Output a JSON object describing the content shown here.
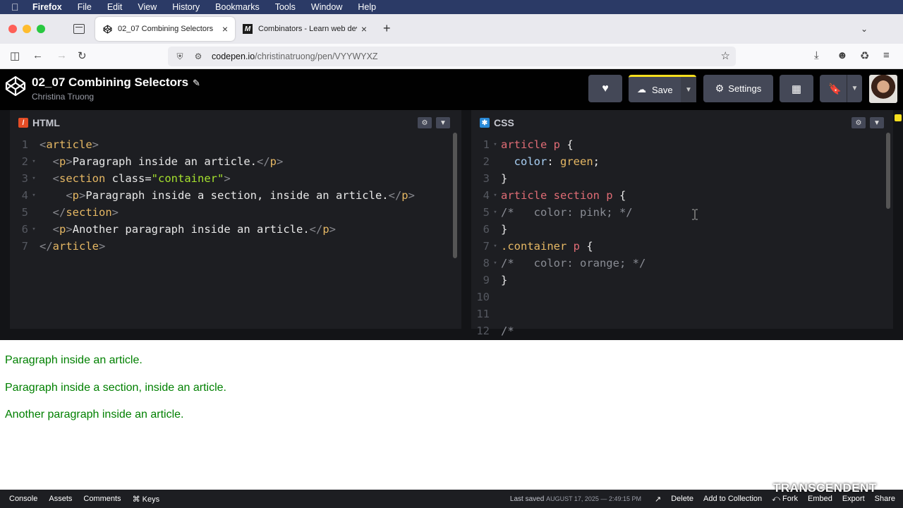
{
  "menubar": {
    "app": "Firefox",
    "items": [
      "File",
      "Edit",
      "View",
      "History",
      "Bookmarks",
      "Tools",
      "Window",
      "Help"
    ]
  },
  "browser": {
    "tabs": [
      {
        "title": "02_07 Combining Selectors",
        "active": true
      },
      {
        "title": "Combinators - Learn web develo",
        "active": false
      }
    ],
    "url_host": "codepen.io",
    "url_path": "/christinatruong/pen/VYYWYXZ"
  },
  "codepen": {
    "pen_title": "02_07 Combining Selectors",
    "author": "Christina Truong",
    "buttons": {
      "save": "Save",
      "settings": "Settings"
    }
  },
  "editors": {
    "html": {
      "label": "HTML",
      "lines": [
        [
          [
            "t-punct",
            "<"
          ],
          [
            "t-name",
            "article"
          ],
          [
            "t-punct",
            ">"
          ]
        ],
        [
          [
            "txt",
            "  "
          ],
          [
            "t-punct",
            "<"
          ],
          [
            "t-name",
            "p"
          ],
          [
            "t-punct",
            ">"
          ],
          [
            "t-white",
            "Paragraph inside an article."
          ],
          [
            "t-punct",
            "</"
          ],
          [
            "t-name",
            "p"
          ],
          [
            "t-punct",
            ">"
          ]
        ],
        [
          [
            "txt",
            "  "
          ],
          [
            "t-punct",
            "<"
          ],
          [
            "t-name",
            "section"
          ],
          [
            "t-white",
            " class="
          ],
          [
            "t-str",
            "\"container\""
          ],
          [
            "t-punct",
            ">"
          ]
        ],
        [
          [
            "txt",
            "    "
          ],
          [
            "t-punct",
            "<"
          ],
          [
            "t-name",
            "p"
          ],
          [
            "t-punct",
            ">"
          ],
          [
            "t-white",
            "Paragraph inside a section, inside an article."
          ],
          [
            "t-punct",
            "</"
          ],
          [
            "t-name",
            "p"
          ],
          [
            "t-punct",
            ">"
          ]
        ],
        [
          [
            "txt",
            "  "
          ],
          [
            "t-punct",
            "</"
          ],
          [
            "t-name",
            "section"
          ],
          [
            "t-punct",
            ">"
          ]
        ],
        [
          [
            "txt",
            "  "
          ],
          [
            "t-punct",
            "<"
          ],
          [
            "t-name",
            "p"
          ],
          [
            "t-punct",
            ">"
          ],
          [
            "t-white",
            "Another paragraph inside an article."
          ],
          [
            "t-punct",
            "</"
          ],
          [
            "t-name",
            "p"
          ],
          [
            "t-punct",
            ">"
          ]
        ],
        [
          [
            "t-punct",
            "</"
          ],
          [
            "t-name",
            "article"
          ],
          [
            "t-punct",
            ">"
          ]
        ]
      ]
    },
    "css": {
      "label": "CSS",
      "lines": [
        [
          [
            "t-sel",
            "article p"
          ],
          [
            "t-white",
            " {"
          ]
        ],
        [
          [
            "t-prop",
            "  color"
          ],
          [
            "t-white",
            ": "
          ],
          [
            "t-val",
            "green"
          ],
          [
            "t-white",
            ";"
          ]
        ],
        [
          [
            "t-white",
            "}"
          ]
        ],
        [
          [
            "t-sel",
            "article section p"
          ],
          [
            "t-white",
            " {"
          ]
        ],
        [
          [
            "t-com",
            "/*   color: pink; */"
          ]
        ],
        [
          [
            "t-white",
            "}"
          ]
        ],
        [
          [
            "t-val",
            ".container"
          ],
          [
            "t-sel",
            " p"
          ],
          [
            "t-white",
            " {"
          ]
        ],
        [
          [
            "t-com",
            "/*   color: orange; */"
          ]
        ],
        [
          [
            "t-white",
            "}"
          ]
        ],
        [],
        [],
        [
          [
            "t-com",
            "/*"
          ]
        ]
      ]
    }
  },
  "result": {
    "paragraphs": [
      "Paragraph inside an article.",
      "Paragraph inside a section, inside an article.",
      "Another paragraph inside an article."
    ]
  },
  "footer": {
    "left": [
      "Console",
      "Assets",
      "Comments",
      "⌘ Keys"
    ],
    "last_saved_label": "Last saved",
    "last_saved_time": "AUGUST 17, 2025 — 2:49:15 PM",
    "right": [
      "Delete",
      "Add to Collection",
      "Fork",
      "Embed",
      "Export",
      "Share"
    ]
  },
  "watermark": "TRANSCENDENT",
  "colors": {
    "accent_yellow": "#f7df1e",
    "result_text": "#008000",
    "editor_bg": "#1d1e22"
  }
}
